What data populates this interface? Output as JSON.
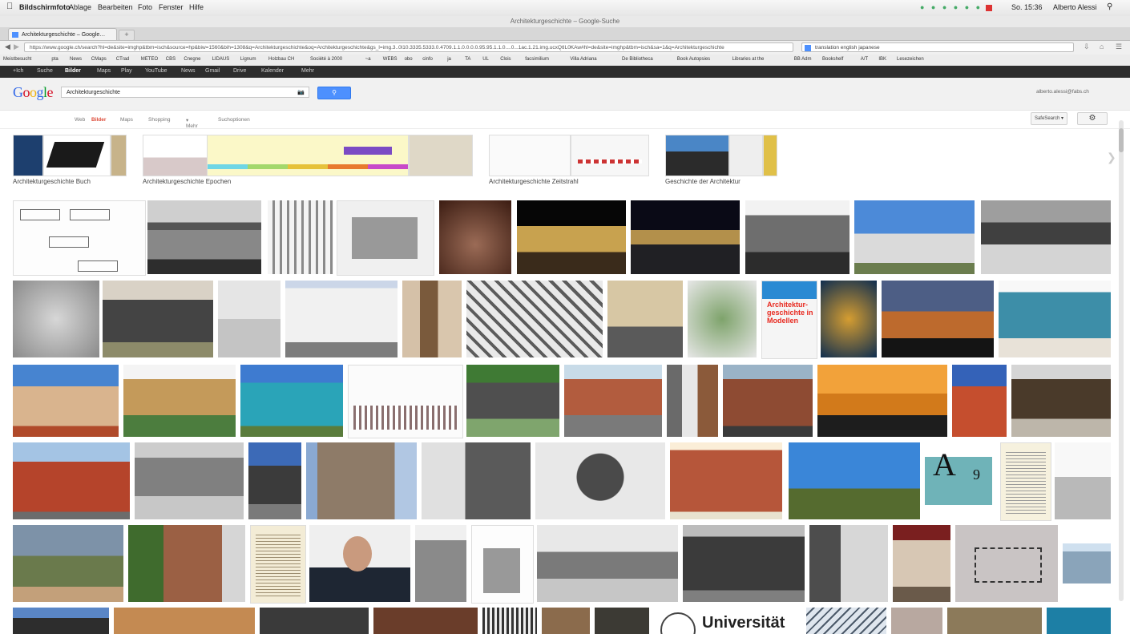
{
  "menubar": {
    "apple": "",
    "app": "Bildschirmfoto",
    "items": [
      "Ablage",
      "Bearbeiten",
      "Foto",
      "Fenster",
      "Hilfe"
    ],
    "clock": "So. 15:36",
    "user": "Alberto Alessi"
  },
  "window": {
    "title": "Architekturgeschichte – Google-Suche"
  },
  "tab": {
    "label": "Architekturgeschichte – Google…",
    "new_tab": "+"
  },
  "address": {
    "url": "https://www.google.ch/search?hl=de&site=imghp&tbm=isch&source=hp&biw=1560&bih=1308&q=Architekturgeschichte&oq=Architekturgeschichte&gs_l=img.3..0l10.3335.5333.0.4709.1.1.0.0.0.0.95.95.1.1.0....0...1ac.1.21.img.ucxQtIL0KAw#hl=de&site=imghp&tbm=isch&sa=1&q=Architekturgeschichte",
    "search_value": "translation english japanese"
  },
  "bookmarks": [
    "Meistbesucht",
    "pta",
    "News",
    "CMaps",
    "CTrad",
    "METEO",
    "CBS",
    "Cnegne",
    "LIDAUS",
    "Lignum",
    "Holzbau CH",
    "Société à 2000",
    "~a",
    "WEBS",
    "obo",
    "cinfo",
    "ja",
    "TA",
    "UL",
    "Clois",
    "facsimilium",
    "Villa Adriana",
    "De Bibliotheca",
    "Book Autopsies",
    "Libraries at the",
    "BB Adm",
    "Bookshelf",
    "A/T",
    "IBK",
    "Lesezeichen"
  ],
  "gbar": {
    "items": [
      "+Ich",
      "Suche",
      "Bilder",
      "Maps",
      "Play",
      "YouTube",
      "News",
      "Gmail",
      "Drive",
      "Kalender",
      "Mehr"
    ],
    "selected_index": 2
  },
  "search": {
    "logo": "Google",
    "query": "Architekturgeschichte",
    "button_icon": "search-icon",
    "user": "alberto.alessi@fabs.ch"
  },
  "subnav": {
    "items": [
      "Web",
      "Bilder",
      "Maps",
      "Shopping",
      "Mehr",
      "Suchoptionen"
    ],
    "active_index": 1,
    "safesearch": "SafeSearch",
    "settings_icon": "gear-icon"
  },
  "related": [
    {
      "label": "Architekturgeschichte Buch"
    },
    {
      "label": "Architekturgeschichte Epochen"
    },
    {
      "label": "Architekturgeschichte Zeitstrahl"
    },
    {
      "label": "Geschichte der Architektur"
    }
  ],
  "result_text": {
    "book_title": "Architektur-geschichte in Modellen",
    "university": "Universität",
    "letter": "A",
    "number": "9"
  },
  "colors": {
    "accent": "#4d90fe",
    "active_tab": "#dd4b39",
    "gbar": "#2d2d2d"
  }
}
